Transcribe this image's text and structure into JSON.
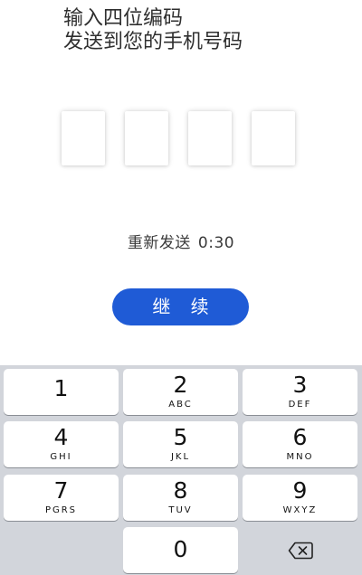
{
  "header": {
    "line1": "输入四位编码",
    "line2": "发送到您的手机号码"
  },
  "code_inputs": [
    "",
    "",
    "",
    ""
  ],
  "resend": {
    "label": "重新发送",
    "timer": "0:30"
  },
  "continue_button": {
    "label": "继 续",
    "color": "#1f5bd6"
  },
  "keypad": {
    "keys": [
      {
        "digit": "1",
        "letters": ""
      },
      {
        "digit": "2",
        "letters": "ABC"
      },
      {
        "digit": "3",
        "letters": "DEF"
      },
      {
        "digit": "4",
        "letters": "GHI"
      },
      {
        "digit": "5",
        "letters": "JKL"
      },
      {
        "digit": "6",
        "letters": "MNO"
      },
      {
        "digit": "7",
        "letters": "PGRS"
      },
      {
        "digit": "8",
        "letters": "TUV"
      },
      {
        "digit": "9",
        "letters": "WXYZ"
      },
      {
        "digit": "0",
        "letters": ""
      }
    ],
    "delete_icon": "backspace-icon",
    "background": "#d2d5db"
  }
}
